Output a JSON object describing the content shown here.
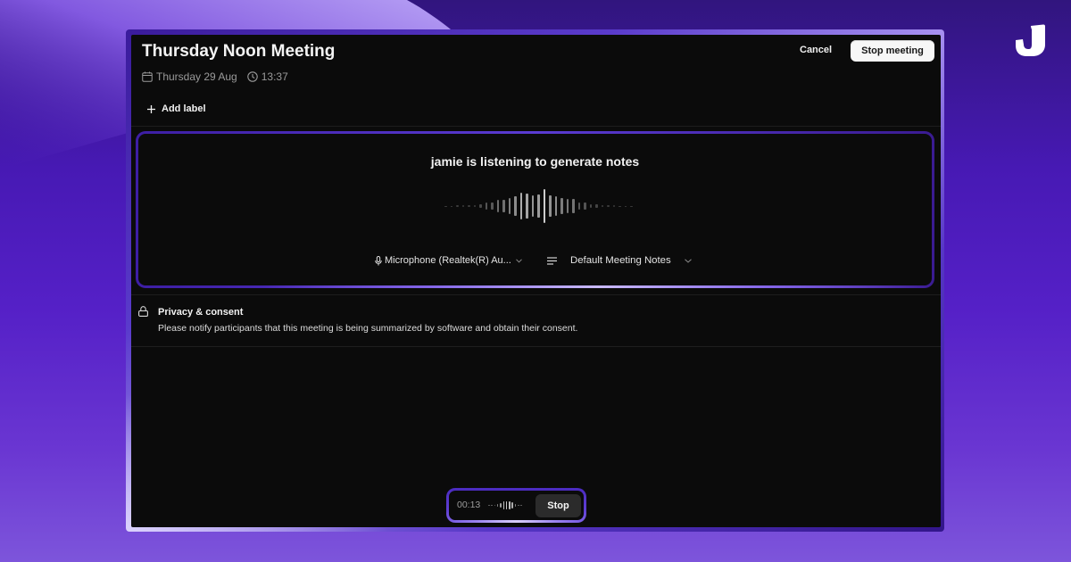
{
  "brand": {
    "logo_icon": "jamie-logo-icon"
  },
  "header": {
    "title": "Thursday Noon Meeting",
    "date": "Thursday 29 Aug",
    "time": "13:37",
    "add_label": "Add label",
    "cancel_label": "Cancel",
    "stop_meeting_label": "Stop meeting"
  },
  "listening": {
    "title": "jamie is listening to generate notes",
    "waveform_levels": [
      0.02,
      0.02,
      0.03,
      0.03,
      0.03,
      0.05,
      0.1,
      0.18,
      0.2,
      0.33,
      0.35,
      0.43,
      0.53,
      0.73,
      0.68,
      0.58,
      0.63,
      0.93,
      0.58,
      0.53,
      0.43,
      0.4,
      0.38,
      0.2,
      0.18,
      0.1,
      0.08,
      0.05,
      0.03,
      0.03,
      0.02,
      0.02,
      0.01
    ],
    "microphone": {
      "selected": "Microphone (Realtek(R) Au...",
      "icon": "microphone-icon"
    },
    "template": {
      "selected": "Default Meeting Notes",
      "icon": "text-lines-icon"
    }
  },
  "privacy": {
    "title": "Privacy & consent",
    "description": "Please notify participants that this meeting is being summarized by software and obtain their consent.",
    "icon": "lock-icon"
  },
  "recorder": {
    "elapsed": "00:13",
    "stop_label": "Stop",
    "mini_waveform_levels": [
      0.1,
      0.1,
      0.1,
      0.35,
      0.6,
      0.9,
      1.0,
      0.9,
      0.75,
      0.3,
      0.1,
      0.1
    ]
  },
  "colors": {
    "window_bg": "#0b0b0b",
    "accent_purple": "#5a3bd2",
    "accent_lavender": "#c9bafc",
    "background_deep": "#4719b4",
    "button_light": "#f7f7f7",
    "button_dark": "#2b2b2b"
  }
}
